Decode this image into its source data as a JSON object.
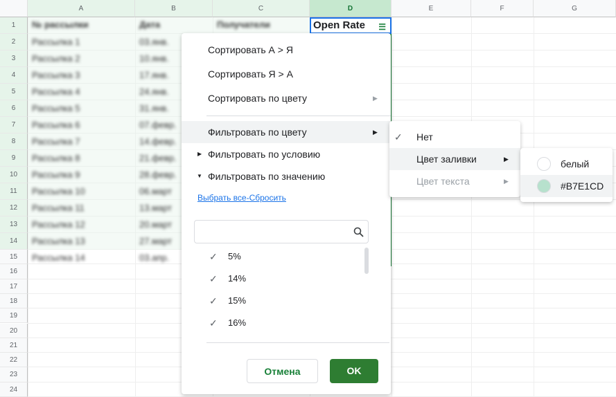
{
  "sheet": {
    "columns": [
      "",
      "A",
      "B",
      "C",
      "D",
      "E",
      "F",
      "G"
    ],
    "rows": [
      "1",
      "2",
      "3",
      "4",
      "5",
      "6",
      "7",
      "8",
      "9",
      "10",
      "11",
      "12",
      "13",
      "14",
      "15",
      "16",
      "17",
      "18",
      "19",
      "20",
      "21",
      "22",
      "23",
      "24"
    ],
    "headers": [
      "№ рассылки",
      "Дата",
      "Получатели",
      "Open Rate"
    ],
    "colA": [
      "Рассылка 1",
      "Рассылка 2",
      "Рассылка 3",
      "Рассылка 4",
      "Рассылка 5",
      "Рассылка 6",
      "Рассылка 7",
      "Рассылка 8",
      "Рассылка 9",
      "Рассылка 10",
      "Рассылка 11",
      "Рассылка 12",
      "Рассылка 13",
      "Рассылка 14"
    ],
    "colB": [
      "03.янв.",
      "10.янв.",
      "17.янв.",
      "24.янв.",
      "31.янв.",
      "07.февр.",
      "14.февр.",
      "21.февр.",
      "28.февр.",
      "06.март",
      "13.март",
      "20.март",
      "27.март",
      "03.апр."
    ]
  },
  "menu": {
    "sort_az": "Сортировать А > Я",
    "sort_za": "Сортировать Я > А",
    "sort_color": "Сортировать по цвету",
    "filter_color": "Фильтровать по цвету",
    "filter_condition": "Фильтровать по условию",
    "filter_value": "Фильтровать по значению",
    "select_all": "Выбрать все",
    "separator": "-",
    "reset": "Сбросить",
    "search_placeholder": "",
    "values": [
      "5%",
      "14%",
      "15%",
      "16%"
    ],
    "cancel": "Отмена",
    "ok": "OK"
  },
  "submenu": {
    "none": "Нет",
    "fill_color": "Цвет заливки",
    "text_color": "Цвет текста"
  },
  "colors": {
    "items": [
      {
        "label": "белый",
        "hex": "#FFFFFF"
      },
      {
        "label": "#B7E1CD",
        "hex": "#B7E1CD"
      }
    ],
    "accent": "#188038"
  }
}
